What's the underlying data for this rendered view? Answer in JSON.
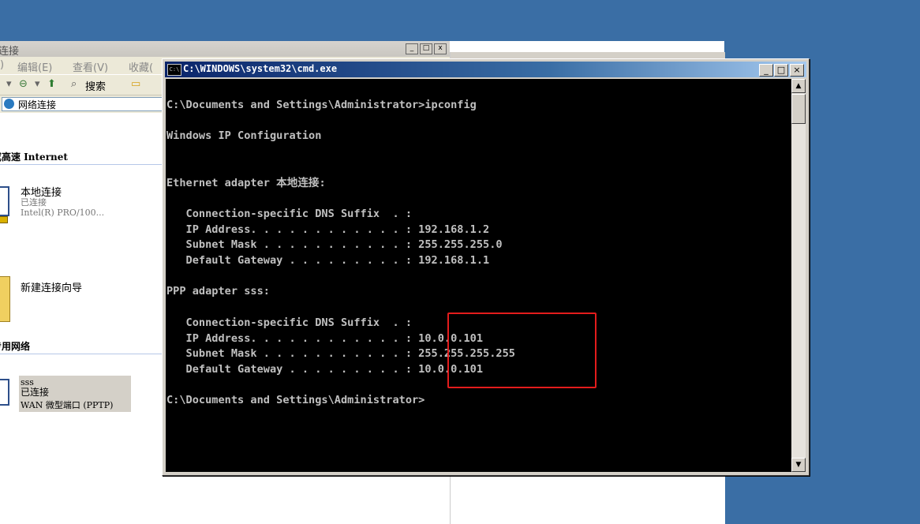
{
  "explorer": {
    "title": "连接",
    "menu": [
      "编辑(E)",
      "查看(V)",
      "收藏("
    ],
    "toolbar_search": "搜索",
    "address": "网络连接",
    "section_internet": "或高速 Internet",
    "section_private": "专用网络",
    "items": [
      {
        "name": "本地连接",
        "status": "已连接",
        "device": "Intel(R) PRO/100..."
      },
      {
        "name": "新建连接向导"
      },
      {
        "name": "sss",
        "status": "已连接",
        "device": "WAN 微型端口 (PPTP)"
      }
    ]
  },
  "cmd": {
    "title": "C:\\WINDOWS\\system32\\cmd.exe",
    "buttons": {
      "minimize": "_",
      "maximize": "□",
      "close": "×"
    },
    "lines": [
      "C:\\Documents and Settings\\Administrator>ipconfig",
      "",
      "Windows IP Configuration",
      "",
      "",
      "Ethernet adapter 本地连接:",
      "",
      "   Connection-specific DNS Suffix  . :",
      "   IP Address. . . . . . . . . . . . : 192.168.1.2",
      "   Subnet Mask . . . . . . . . . . . : 255.255.255.0",
      "   Default Gateway . . . . . . . . . : 192.168.1.1",
      "",
      "PPP adapter sss:",
      "",
      "   Connection-specific DNS Suffix  . :",
      "   IP Address. . . . . . . . . . . . : 10.0.0.101",
      "   Subnet Mask . . . . . . . . . . . : 255.255.255.255",
      "   Default Gateway . . . . . . . . . : 10.0.0.101",
      "",
      "C:\\Documents and Settings\\Administrator>"
    ]
  },
  "colors": {
    "desktop": "#3a6ea5",
    "highlight_box": "#e31c1c",
    "console_text": "#c0c0c0",
    "console_bg": "#000000"
  }
}
